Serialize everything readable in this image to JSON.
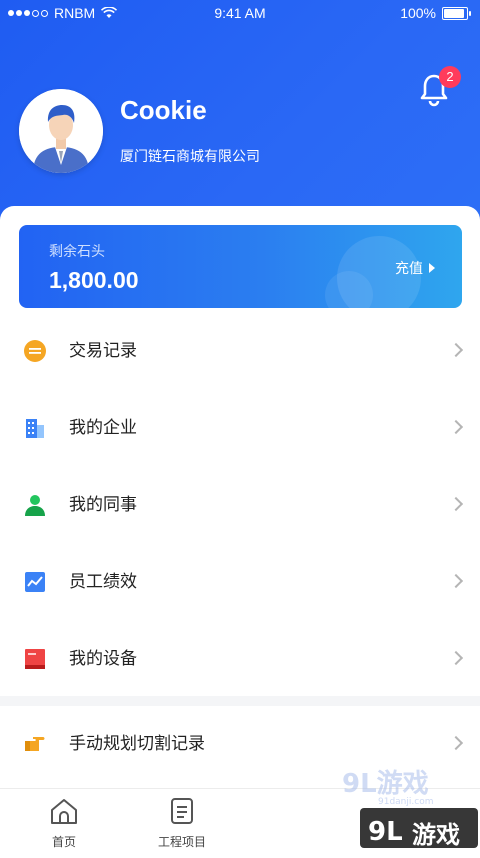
{
  "status_bar": {
    "carrier": "RNBM",
    "time": "9:41 AM",
    "battery": "100%",
    "battery_level": 1.0
  },
  "notifications": {
    "count": "2"
  },
  "profile": {
    "name": "Cookie",
    "company": "厦门链石商城有限公司"
  },
  "balance_card": {
    "label": "剩余石头",
    "amount": "1,800.00",
    "action": "充值"
  },
  "menu": [
    {
      "label": "交易记录",
      "icon": "transaction-icon",
      "color": "#f5a623"
    },
    {
      "label": "我的企业",
      "icon": "building-icon",
      "color": "#3b82f6"
    },
    {
      "label": "我的同事",
      "icon": "person-icon",
      "color": "#22c55e"
    },
    {
      "label": "员工绩效",
      "icon": "chart-icon",
      "color": "#3b82f6"
    },
    {
      "label": "我的设备",
      "icon": "device-icon",
      "color": "#ef4444"
    },
    {
      "label": "手动规划切割记录",
      "icon": "pointing-hand-icon",
      "color": "#f5a623"
    }
  ],
  "tabs": [
    {
      "label": "首页",
      "icon": "home-icon"
    },
    {
      "label": "工程项目",
      "icon": "document-icon"
    }
  ],
  "watermark": {
    "text": "游戏",
    "site": "91danji.com"
  }
}
